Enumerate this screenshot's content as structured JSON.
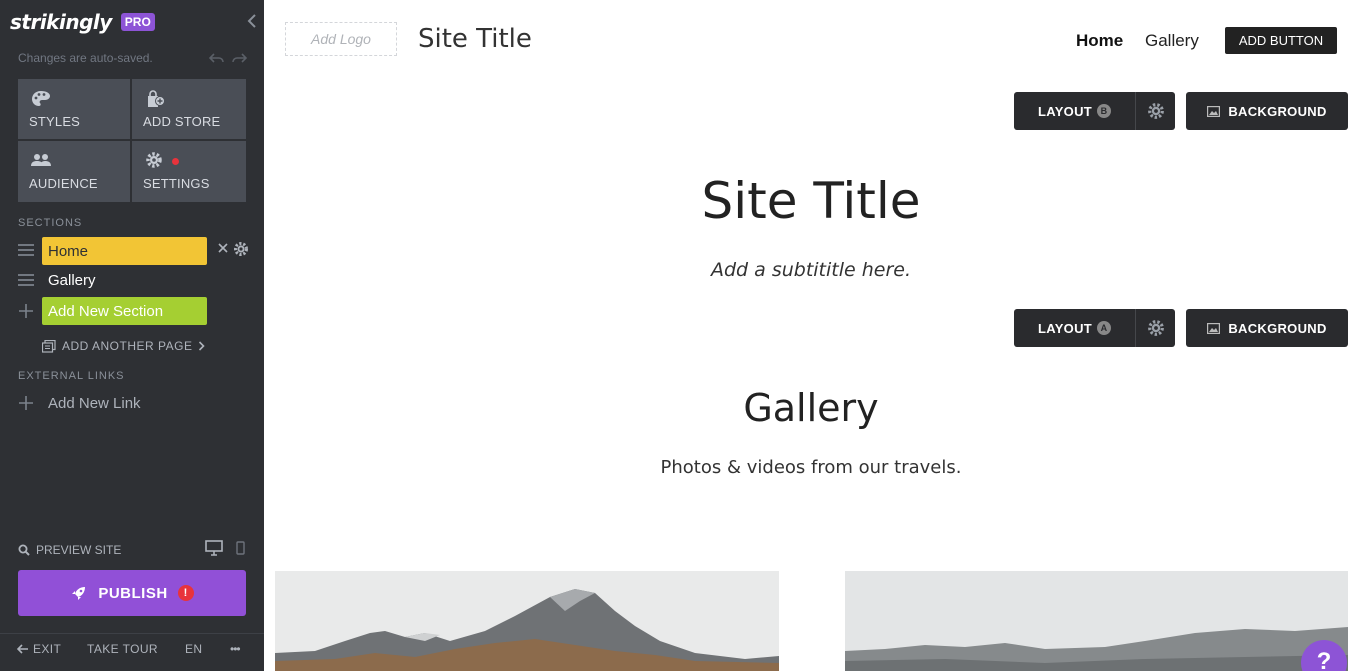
{
  "sidebar": {
    "brand": "strikingly",
    "badge": "PRO",
    "autosave": "Changes are auto-saved.",
    "tiles": [
      {
        "label": "STYLES",
        "icon": "palette-icon"
      },
      {
        "label": "ADD STORE",
        "icon": "store-add-icon"
      },
      {
        "label": "AUDIENCE",
        "icon": "people-icon"
      },
      {
        "label": "SETTINGS",
        "icon": "gear-icon"
      }
    ],
    "sections_label": "SECTIONS",
    "sections": [
      {
        "label": "Home"
      },
      {
        "label": "Gallery"
      }
    ],
    "add_section": "Add New Section",
    "add_page": "ADD ANOTHER PAGE",
    "external_links_label": "EXTERNAL LINKS",
    "add_link": "Add New Link",
    "preview": "PREVIEW SITE",
    "publish": "PUBLISH",
    "publish_alert": "!",
    "footer": {
      "exit": "EXIT",
      "tour": "TAKE TOUR",
      "lang": "EN",
      "more": "•••"
    },
    "colors": {
      "bg": "#2e3034",
      "home": "#f2c535",
      "add_section": "#a5cf32",
      "publish": "#9150d7"
    }
  },
  "site": {
    "add_logo": "Add Logo",
    "nav_title": "Site Title",
    "nav_links": [
      "Home",
      "Gallery"
    ],
    "nav_button": "ADD BUTTON",
    "hero": {
      "layout_label": "LAYOUT",
      "layout_badge": "B",
      "background_label": "BACKGROUND",
      "title": "Site Title",
      "subtitle": "Add a subtititle here."
    },
    "gallery": {
      "layout_label": "LAYOUT",
      "layout_badge": "A",
      "background_label": "BACKGROUND",
      "title": "Gallery",
      "subtitle": "Photos & videos from our travels."
    },
    "help": "?"
  }
}
